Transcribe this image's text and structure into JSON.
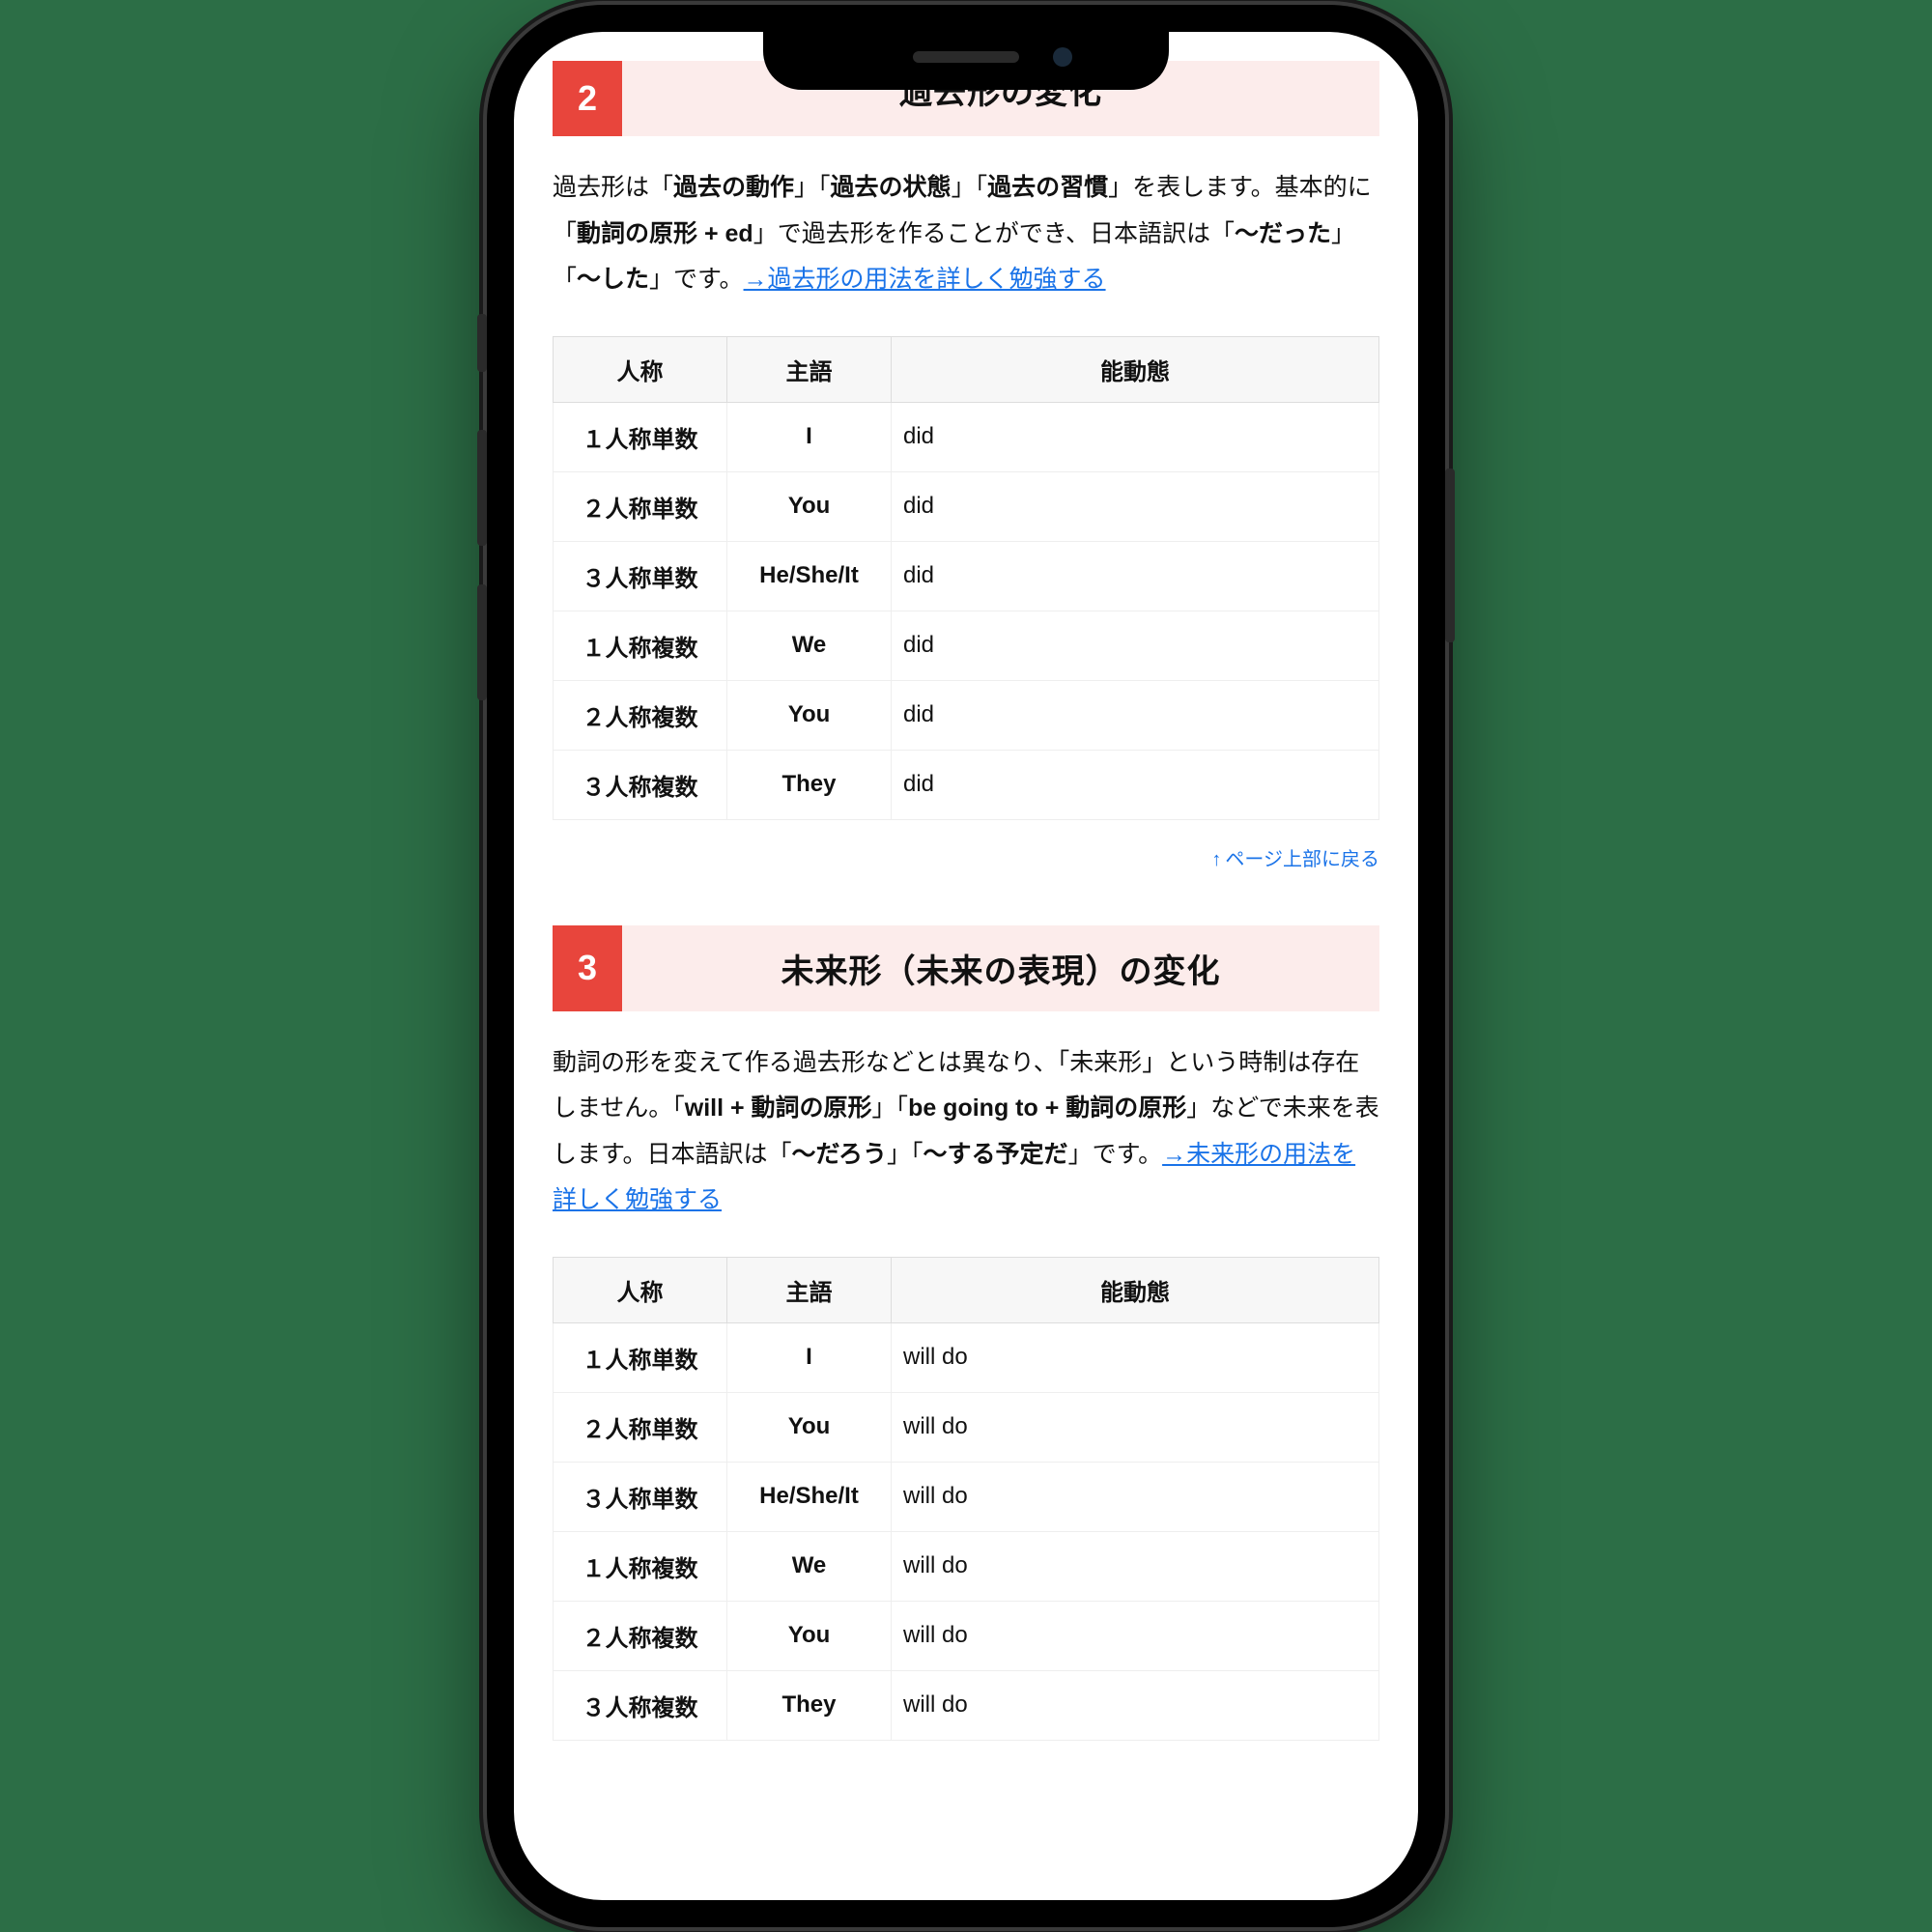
{
  "sections": [
    {
      "num": "2",
      "title": "過去形の変化",
      "para_parts": {
        "p0": "過去形は「",
        "b0": "過去の動作",
        "p1": "」「",
        "b1": "過去の状態",
        "p2": "」「",
        "b2": "過去の習慣",
        "p3": "」を表します。基本的に「",
        "b3": "動詞の原形 + ed",
        "p4": "」で過去形を作ることができ、日本語訳は「",
        "b4": "〜だった",
        "p5": "」「",
        "b5": "〜した",
        "p6": "」です。",
        "link": "→過去形の用法を詳しく勉強する"
      },
      "table": {
        "headers": [
          "人称",
          "主語",
          "能動態"
        ],
        "rows": [
          [
            "１人称単数",
            "I",
            "did"
          ],
          [
            "２人称単数",
            "You",
            "did"
          ],
          [
            "３人称単数",
            "He/She/It",
            "did"
          ],
          [
            "１人称複数",
            "We",
            "did"
          ],
          [
            "２人称複数",
            "You",
            "did"
          ],
          [
            "３人称複数",
            "They",
            "did"
          ]
        ]
      }
    },
    {
      "num": "3",
      "title": "未来形（未来の表現）の変化",
      "para_parts": {
        "p0": "動詞の形を変えて作る過去形などとは異なり、「未来形」という時制は存在しません。「",
        "b0": "will + 動詞の原形",
        "p1": "」「",
        "b1": "be going to + 動詞の原形",
        "p2": "」などで未来を表します。日本語訳は「",
        "b2": "〜だろう",
        "p3": "」「",
        "b3": "〜する予定だ",
        "p4": "」です。",
        "link": "→未来形の用法を詳しく勉強する"
      },
      "table": {
        "headers": [
          "人称",
          "主語",
          "能動態"
        ],
        "rows": [
          [
            "１人称単数",
            "I",
            "will do"
          ],
          [
            "２人称単数",
            "You",
            "will do"
          ],
          [
            "３人称単数",
            "He/She/It",
            "will do"
          ],
          [
            "１人称複数",
            "We",
            "will do"
          ],
          [
            "２人称複数",
            "You",
            "will do"
          ],
          [
            "３人称複数",
            "They",
            "will do"
          ]
        ]
      }
    }
  ],
  "back_to_top": {
    "arrow": "↑",
    "label": "ページ上部に戻る"
  }
}
